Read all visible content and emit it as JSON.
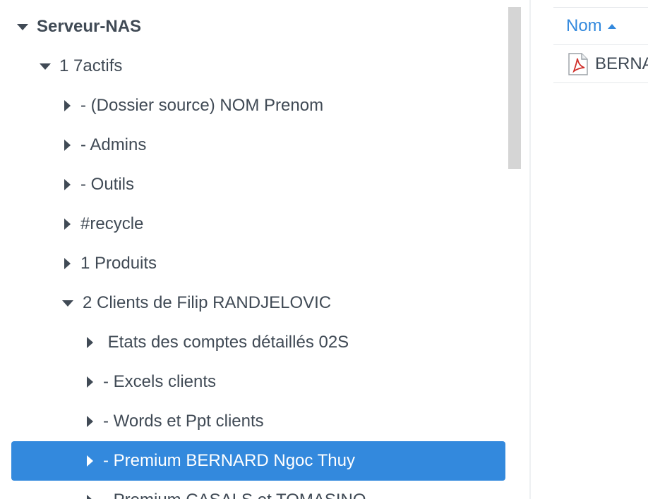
{
  "tree": {
    "nodes": [
      {
        "label": "Serveur-NAS"
      },
      {
        "label": "1 7actifs"
      },
      {
        "label": "- (Dossier source) NOM Prenom"
      },
      {
        "label": "- Admins"
      },
      {
        "label": "- Outils"
      },
      {
        "label": "#recycle"
      },
      {
        "label": "1 Produits"
      },
      {
        "label": "2 Clients de Filip RANDJELOVIC"
      },
      {
        "label": " Etats des comptes détaillés 02S"
      },
      {
        "label": "- Excels clients"
      },
      {
        "label": "- Words et Ppt clients"
      },
      {
        "label": "- Premium BERNARD Ngoc Thuy"
      },
      {
        "label": "- Premium CASALS et TOMASINO"
      }
    ]
  },
  "file_list": {
    "column_name": "Nom",
    "files": [
      {
        "name": "BERNARD",
        "icon": "pdf-file-icon"
      }
    ]
  },
  "colors": {
    "accent": "#3389dd",
    "text": "#404a55",
    "selected_text": "#ffffff"
  }
}
